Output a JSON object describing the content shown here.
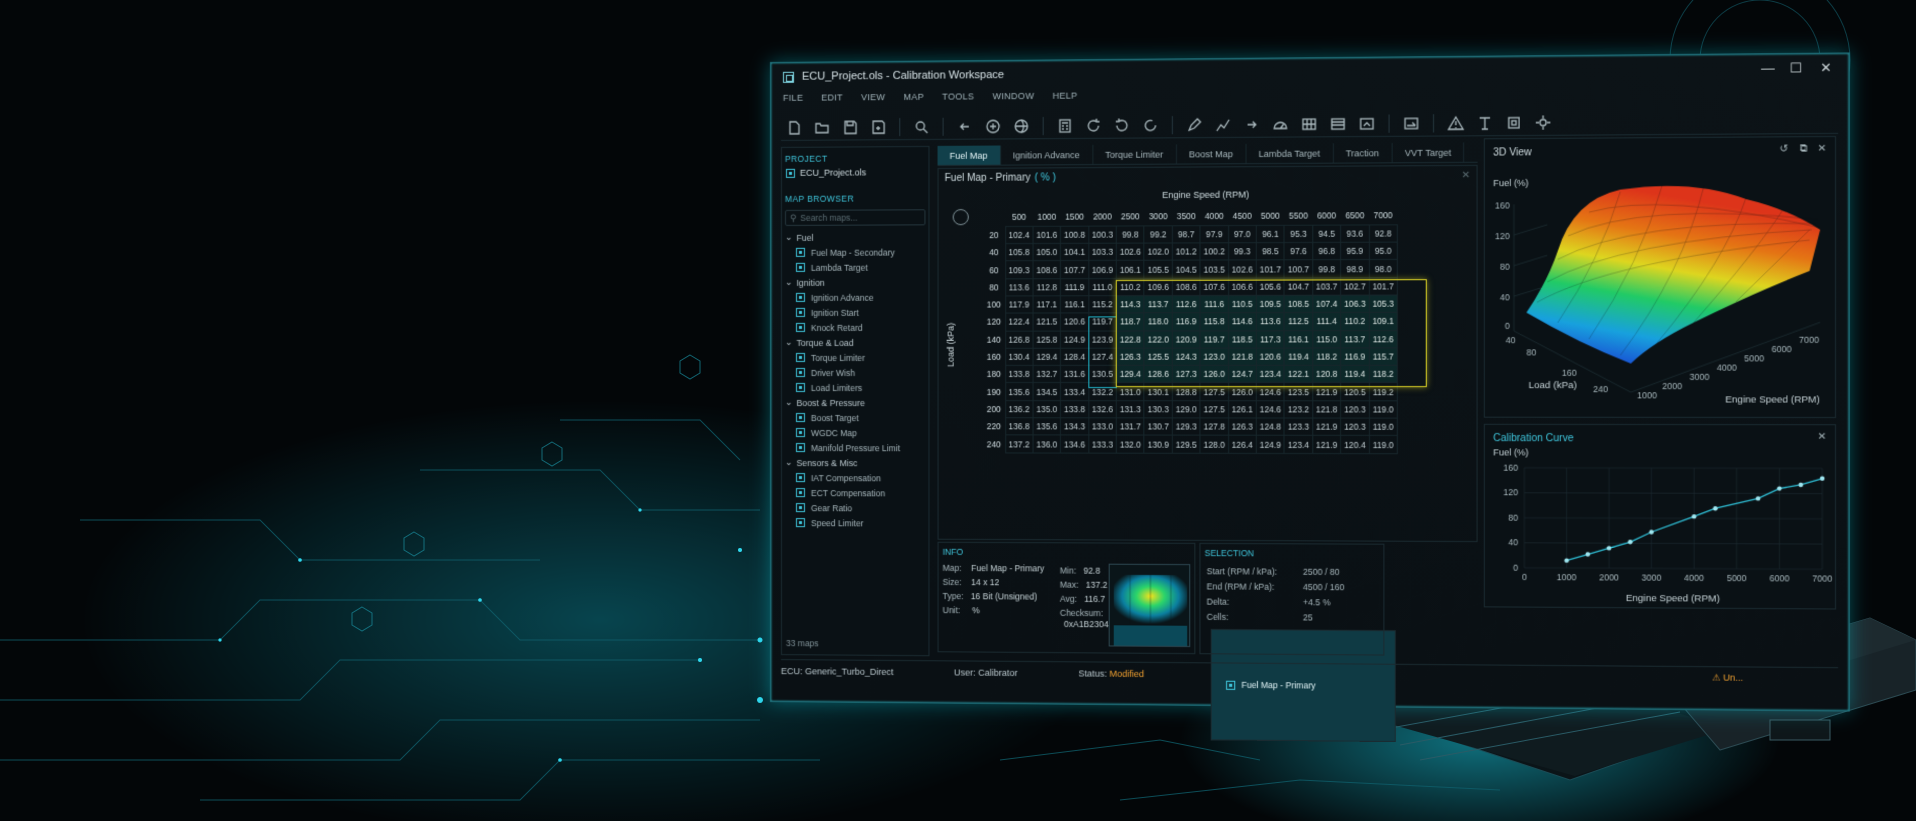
{
  "window": {
    "title": "ECU_Project.ols - Calibration Workspace",
    "minimize": "—",
    "maximize": "☐",
    "close": "✕"
  },
  "menu": [
    "FILE",
    "EDIT",
    "VIEW",
    "MAP",
    "TOOLS",
    "WINDOW",
    "HELP"
  ],
  "toolbar_icons": [
    "new-file-icon",
    "open-folder-icon",
    "save-icon",
    "save-as-icon",
    "compare-icon",
    "undo-icon",
    "add-icon",
    "globe-icon",
    "calculator-icon",
    "refresh-icon",
    "rotate-left-icon",
    "rotate-right-icon",
    "pen-icon",
    "graph-icon",
    "redo-icon",
    "gauge-icon",
    "grid-icon",
    "table-icon",
    "export-icon",
    "arrow-icon",
    "warning-icon",
    "text-icon",
    "chip-icon",
    "settings-icon"
  ],
  "project": {
    "header": "PROJECT",
    "name": "ECU_Project.ols",
    "map_browser": "MAP BROWSER",
    "search_placeholder": "Search maps...",
    "groups": [
      {
        "name": "Fuel",
        "items": [
          "Fuel Map - Primary",
          "Fuel Map - Secondary",
          "Lambda Target"
        ]
      },
      {
        "name": "Ignition",
        "items": [
          "Ignition Advance",
          "Ignition Start",
          "Knock Retard"
        ]
      },
      {
        "name": "Torque & Load",
        "items": [
          "Torque Limiter",
          "Driver Wish",
          "Load Limiters"
        ]
      },
      {
        "name": "Boost & Pressure",
        "items": [
          "Boost Target",
          "WGDC Map",
          "Manifold Pressure Limit"
        ]
      },
      {
        "name": "Sensors & Misc",
        "items": [
          "IAT Compensation",
          "ECT Compensation",
          "Gear Ratio",
          "Speed Limiter"
        ]
      }
    ],
    "count": "33 maps"
  },
  "tabs": [
    "Fuel Map",
    "Ignition Advance",
    "Torque Limiter",
    "Boost Map",
    "Lambda Target",
    "Traction",
    "VVT Target"
  ],
  "map": {
    "title": "Fuel Map - Primary",
    "unit": "( % )",
    "x_label": "Engine Speed (RPM)",
    "y_label": "Load (kPa)",
    "rpm": [
      "500",
      "1000",
      "1500",
      "2000",
      "2500",
      "3000",
      "3500",
      "4000",
      "4500",
      "5000",
      "5500",
      "6000",
      "6500",
      "7000"
    ],
    "rows": [
      {
        "load": "20",
        "vals": [
          "102.4",
          "101.6",
          "100.8",
          "100.3",
          "99.8",
          "99.2",
          "98.7",
          "97.9",
          "97.0",
          "96.1",
          "95.3",
          "94.5",
          "93.6",
          "92.8"
        ]
      },
      {
        "load": "40",
        "vals": [
          "105.8",
          "105.0",
          "104.1",
          "103.3",
          "102.6",
          "102.0",
          "101.2",
          "100.2",
          "99.3",
          "98.5",
          "97.6",
          "96.8",
          "95.9",
          "95.0"
        ]
      },
      {
        "load": "60",
        "vals": [
          "109.3",
          "108.6",
          "107.7",
          "106.9",
          "106.1",
          "105.5",
          "104.5",
          "103.5",
          "102.6",
          "101.7",
          "100.7",
          "99.8",
          "98.9",
          "98.0"
        ]
      },
      {
        "load": "80",
        "vals": [
          "113.6",
          "112.8",
          "111.9",
          "111.0",
          "110.2",
          "109.6",
          "108.6",
          "107.6",
          "106.6",
          "105.6",
          "104.7",
          "103.7",
          "102.7",
          "101.7"
        ]
      },
      {
        "load": "100",
        "vals": [
          "117.9",
          "117.1",
          "116.1",
          "115.2",
          "114.3",
          "113.7",
          "112.6",
          "111.6",
          "110.5",
          "109.5",
          "108.5",
          "107.4",
          "106.3",
          "105.3"
        ]
      },
      {
        "load": "120",
        "vals": [
          "122.4",
          "121.5",
          "120.6",
          "119.7",
          "118.7",
          "118.0",
          "116.9",
          "115.8",
          "114.6",
          "113.6",
          "112.5",
          "111.4",
          "110.2",
          "109.1"
        ]
      },
      {
        "load": "140",
        "vals": [
          "126.8",
          "125.8",
          "124.9",
          "123.9",
          "122.8",
          "122.0",
          "120.9",
          "119.7",
          "118.5",
          "117.3",
          "116.1",
          "115.0",
          "113.7",
          "112.6"
        ]
      },
      {
        "load": "160",
        "vals": [
          "130.4",
          "129.4",
          "128.4",
          "127.4",
          "126.3",
          "125.5",
          "124.3",
          "123.0",
          "121.8",
          "120.6",
          "119.4",
          "118.2",
          "116.9",
          "115.7"
        ]
      },
      {
        "load": "180",
        "vals": [
          "133.8",
          "132.7",
          "131.6",
          "130.5",
          "129.4",
          "128.6",
          "127.3",
          "126.0",
          "124.7",
          "123.4",
          "122.1",
          "120.8",
          "119.4",
          "118.2"
        ]
      },
      {
        "load": "190",
        "vals": [
          "135.6",
          "134.5",
          "133.4",
          "132.2",
          "131.0",
          "130.1",
          "128.8",
          "127.5",
          "126.0",
          "124.6",
          "123.5",
          "121.9",
          "120.5",
          "119.2"
        ]
      },
      {
        "load": "200",
        "vals": [
          "136.2",
          "135.0",
          "133.8",
          "132.6",
          "131.3",
          "130.3",
          "129.0",
          "127.5",
          "126.1",
          "124.6",
          "123.2",
          "121.8",
          "120.3",
          "119.0"
        ]
      },
      {
        "load": "220",
        "vals": [
          "136.8",
          "135.6",
          "134.3",
          "133.0",
          "131.7",
          "130.7",
          "129.3",
          "127.8",
          "126.3",
          "124.8",
          "123.3",
          "121.9",
          "120.3",
          "119.0"
        ]
      },
      {
        "load": "240",
        "vals": [
          "137.2",
          "136.0",
          "134.6",
          "133.3",
          "132.0",
          "130.9",
          "129.5",
          "128.0",
          "126.4",
          "124.9",
          "123.4",
          "121.9",
          "120.4",
          "119.0"
        ]
      }
    ]
  },
  "info": {
    "header": "INFO",
    "map_k": "Map:",
    "map_v": "Fuel Map - Primary",
    "size_k": "Size:",
    "size_v": "14 x 12",
    "type_k": "Type:",
    "type_v": "16 Bit (Unsigned)",
    "unit_k": "Unit:",
    "unit_v": "%",
    "min_k": "Min:",
    "min_v": "92.8",
    "max_k": "Max:",
    "max_v": "137.2",
    "avg_k": "Avg:",
    "avg_v": "116.7",
    "chk_k": "Checksum:",
    "chk_v": "0xA1B2304"
  },
  "selection": {
    "header": "SELECTION",
    "start_k": "Start (RPM / kPa):",
    "start_v": "2500 / 80",
    "end_k": "End (RPM / kPa):",
    "end_v": "4500 / 160",
    "delta_k": "Delta:",
    "delta_v": "+4.5 %",
    "cells_k": "Cells:",
    "cells_v": "25"
  },
  "view3d": {
    "title": "3D View",
    "z_label": "Fuel (%)",
    "z_ticks": [
      "160",
      "120",
      "80",
      "40",
      "0"
    ],
    "load_ticks": [
      "40",
      "80",
      "160",
      "240"
    ],
    "rpm_ticks": [
      "1000",
      "2000",
      "3000",
      "4000",
      "5000",
      "6000",
      "7000"
    ],
    "x_label": "Load (kPa)",
    "y_label": "Engine Speed (RPM)"
  },
  "calcurve": {
    "title": "Calibration Curve",
    "y_label": "Fuel (%)",
    "x_label": "Engine Speed (RPM)",
    "y_ticks": [
      "160",
      "120",
      "80",
      "40",
      "0"
    ],
    "x_ticks": [
      "0",
      "1000",
      "2000",
      "3000",
      "4000",
      "5000",
      "6000",
      "7000"
    ]
  },
  "chart_data": {
    "type": "line",
    "title": "Calibration Curve",
    "xlabel": "Engine Speed (RPM)",
    "ylabel": "Fuel (%)",
    "x": [
      1000,
      1500,
      2000,
      2500,
      3000,
      4000,
      4500,
      5500,
      6000,
      6500,
      7000
    ],
    "values": [
      12,
      22,
      32,
      42,
      58,
      83,
      96,
      112,
      128,
      134,
      144
    ],
    "xlim": [
      0,
      7000
    ],
    "ylim": [
      0,
      160
    ],
    "grid": true
  },
  "statusbar": {
    "ecu": "ECU: Generic_Turbo_Direct",
    "user": "User: Calibrator",
    "status_label": "Status:",
    "status_value": "Modified",
    "warning": "Un..."
  },
  "colors": {
    "accent": "#3fc6dc",
    "selection": "#d8cf25",
    "modified": "#f0a030"
  }
}
